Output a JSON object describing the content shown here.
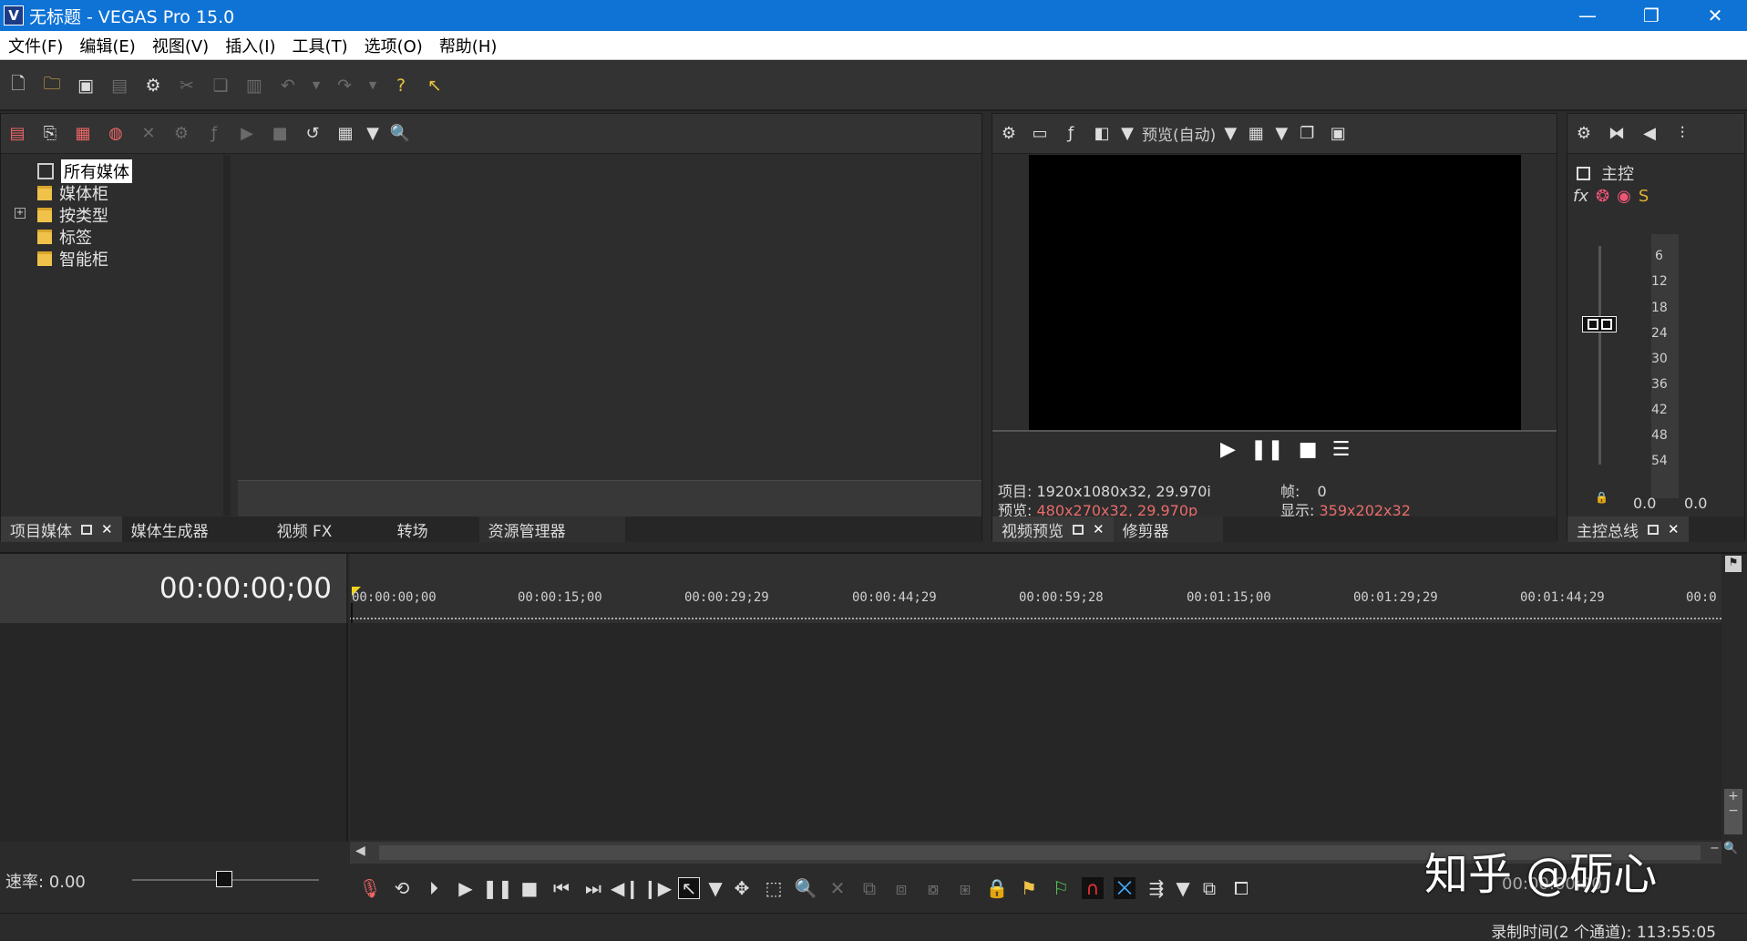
{
  "window": {
    "icon_letter": "V",
    "title": "无标题 - VEGAS Pro 15.0",
    "minimize": "—",
    "restore": "❐",
    "close": "✕"
  },
  "menu": [
    "文件(F)",
    "编辑(E)",
    "视图(V)",
    "插入(I)",
    "工具(T)",
    "选项(O)",
    "帮助(H)"
  ],
  "project_media": {
    "tree": [
      {
        "label": "所有媒体",
        "selected": true
      },
      {
        "label": "媒体柜"
      },
      {
        "label": "按类型",
        "expandable": true,
        "expand_glyph": "+"
      },
      {
        "label": "标签"
      },
      {
        "label": "智能柜"
      }
    ],
    "tabs": [
      "项目媒体",
      "媒体生成器",
      "视频 FX",
      "转场",
      "资源管理器"
    ]
  },
  "preview": {
    "mode_label": "预览(自动)",
    "project_label": "项目:",
    "project_value": "1920x1080x32, 29.970i",
    "preview_label": "预览:",
    "preview_value": "480x270x32, 29.970p",
    "frame_label": "帧:",
    "frame_value": "0",
    "display_label": "显示:",
    "display_value": "359x202x32",
    "tabs": [
      "视频预览",
      "修剪器"
    ]
  },
  "master": {
    "label": "主控",
    "fx_icons": [
      "fx",
      "❂",
      "◉",
      "S"
    ],
    "scale": [
      "6",
      "12",
      "18",
      "24",
      "30",
      "36",
      "42",
      "48",
      "54"
    ],
    "left_value": "0.0",
    "right_value": "0.0",
    "tab": "主控总线"
  },
  "timeline": {
    "timecode": "00:00:00;00",
    "ruler": [
      "00:00:00;00",
      "00:00:15;00",
      "00:00:29;29",
      "00:00:44;29",
      "00:00:59;28",
      "00:01:15;00",
      "00:01:29;29",
      "00:01:44;29",
      "00:0"
    ],
    "rate_label": "速率: 0.00",
    "record_time": "录制时间(2 个通道): 113:55:05",
    "cursor_time": "00:00:00;00"
  },
  "watermark": "知乎 @砺心",
  "colors": {
    "titlebar": "#0f73d6",
    "panel": "#2d2d2d",
    "highlight_value": "#e96b6b",
    "cursor_marker": "#f2d21a"
  }
}
